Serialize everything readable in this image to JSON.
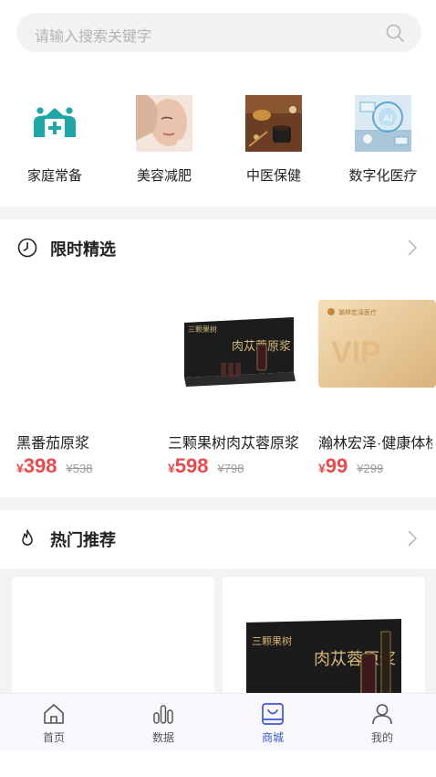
{
  "search": {
    "placeholder": "请输入搜索关键字"
  },
  "categories": [
    {
      "label": "家庭常备",
      "icon": "family-medicine-icon"
    },
    {
      "label": "美容减肥",
      "icon": "beauty-photo"
    },
    {
      "label": "中医保健",
      "icon": "tcm-photo"
    },
    {
      "label": "数字化医疗",
      "icon": "digital-health-photo"
    }
  ],
  "flash_sale": {
    "title": "限时精选",
    "icon": "clock-icon",
    "products": [
      {
        "name": "黑番茄原浆",
        "currency": "¥",
        "price": "398",
        "old_price": "¥538"
      },
      {
        "name": "三颗果树肉苁蓉原浆",
        "currency": "¥",
        "price": "598",
        "old_price": "¥798",
        "brand": "三颗果树",
        "product_text": "肉苁蓉原浆"
      },
      {
        "name": "瀚林宏泽·健康体检卡",
        "currency": "¥",
        "price": "99",
        "old_price": "¥299",
        "brand": "瀚林宏泽医疗",
        "card_text": "VIP"
      }
    ]
  },
  "hot": {
    "title": "热门推荐",
    "icon": "flame-icon",
    "card_brand": "三颗果树",
    "card_product": "肉苁蓉原浆"
  },
  "tabbar": {
    "active": 2,
    "items": [
      {
        "label": "首页",
        "icon": "home-icon"
      },
      {
        "label": "数据",
        "icon": "chart-icon"
      },
      {
        "label": "商城",
        "icon": "shop-icon"
      },
      {
        "label": "我的",
        "icon": "user-icon"
      }
    ]
  },
  "colors": {
    "accent": "#3d57d9",
    "price": "#e94a4a",
    "teal": "#1fa6a6"
  }
}
